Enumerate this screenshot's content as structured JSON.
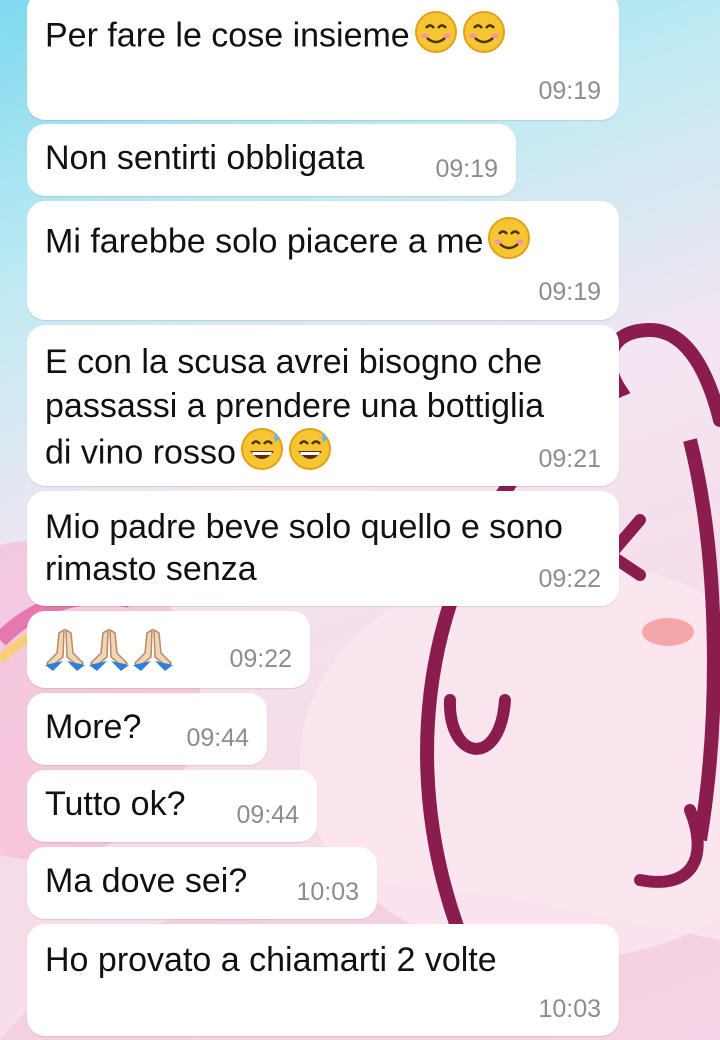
{
  "messages": [
    {
      "text": "Per fare le cose insieme",
      "emoji": [
        "smiling-face-icon",
        "smiling-face-icon"
      ],
      "time": "09:19"
    },
    {
      "text": "Non sentirti obbligata",
      "time": "09:19"
    },
    {
      "text": "Mi farebbe solo piacere a me",
      "emoji": [
        "smiling-face-icon"
      ],
      "time": "09:19"
    },
    {
      "lines": [
        "E con la scusa avrei bisogno che",
        "passassi a prendere una bottiglia",
        "di vino rosso"
      ],
      "emoji": [
        "grinning-sweat-face-icon",
        "grinning-sweat-face-icon"
      ],
      "time": "09:21"
    },
    {
      "lines": [
        "Mio padre beve solo quello e sono",
        "rimasto senza"
      ],
      "time": "09:22"
    },
    {
      "emoji": [
        "folded-hands-icon",
        "folded-hands-icon",
        "folded-hands-icon"
      ],
      "time": "09:22"
    },
    {
      "text": "More?",
      "time": "09:44"
    },
    {
      "text": "Tutto ok?",
      "time": "09:44"
    },
    {
      "text": "Ma dove sei?",
      "time": "10:03"
    },
    {
      "text": "Ho provato a chiamarti 2 volte",
      "time": "10:03"
    }
  ],
  "colors": {
    "bubble": "#ffffff",
    "text": "#111111",
    "timestamp": "#8c8c8c",
    "wallpaper_accent": "#8b1d4e"
  }
}
